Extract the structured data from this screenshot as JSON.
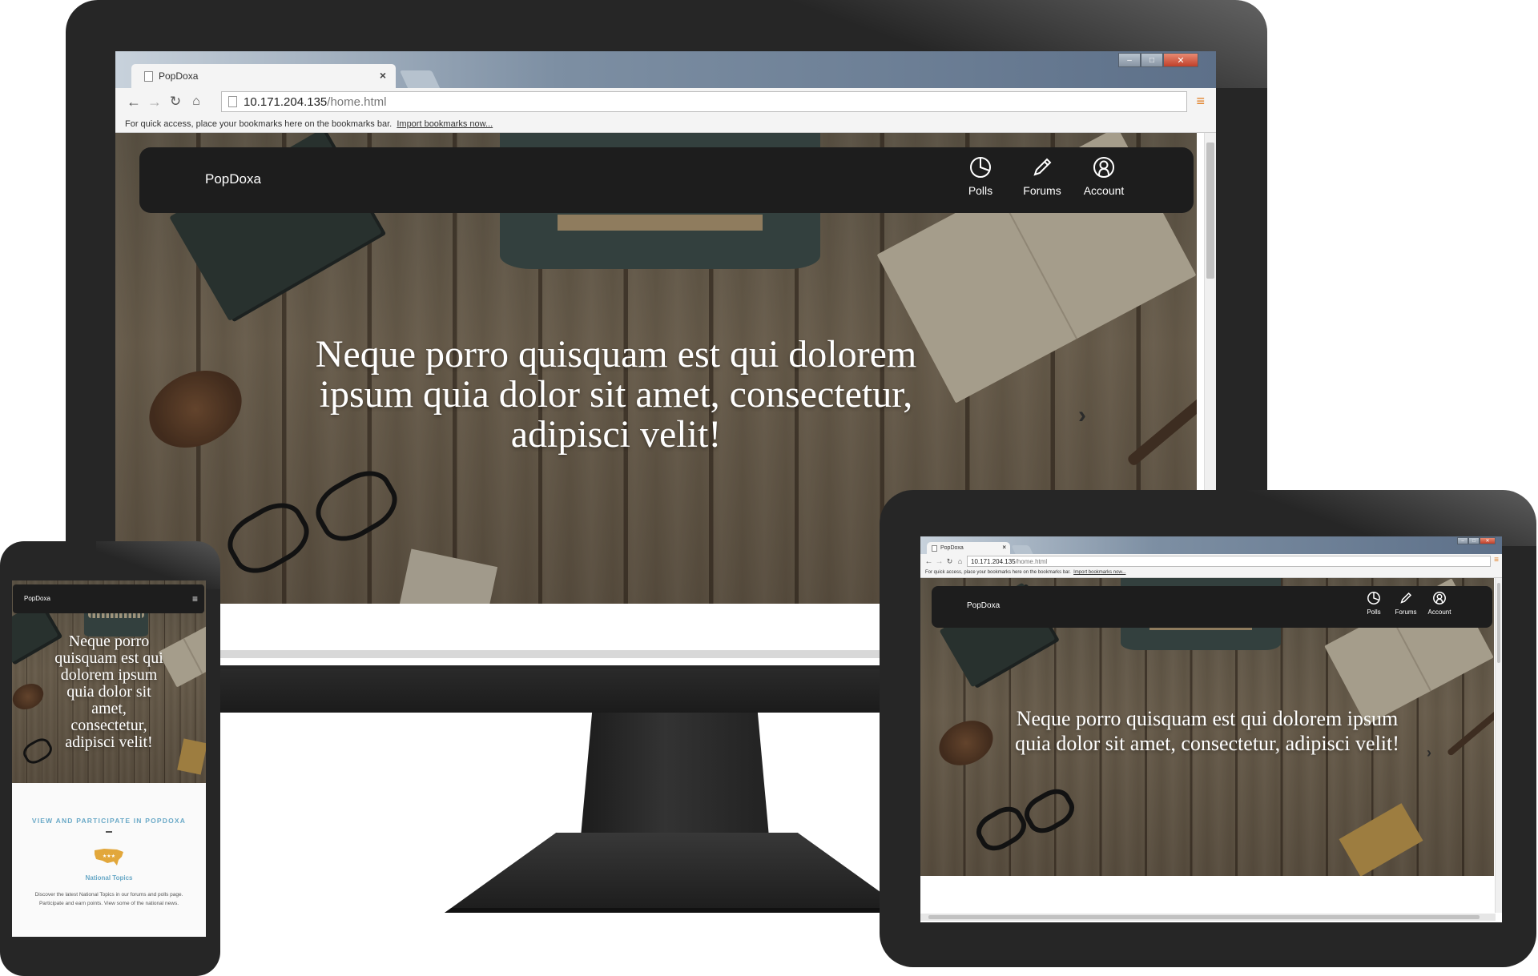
{
  "site": {
    "brand": "PopDoxa",
    "nav": [
      {
        "label": "Polls",
        "icon": "pie-chart-icon"
      },
      {
        "label": "Forums",
        "icon": "pencil-icon"
      },
      {
        "label": "Account",
        "icon": "user-icon"
      }
    ],
    "headline": "Neque porro quisquam est qui dolorem ipsum quia dolor sit amet, consectetur, adipisci velit!",
    "section_title": "VIEW AND PARTICIPATE IN POPDOXA",
    "topic_title": "National Topics",
    "topic_description": "Discover the latest National Topics in our forums and polls page. Participate and earn points. View some of the national news."
  },
  "browser": {
    "tab_title": "PopDoxa",
    "tab_close": "×",
    "url_host": "10.171.204.135",
    "url_path": "/home.html",
    "bookmarks_text": "For quick access, place your bookmarks here on the bookmarks bar.",
    "bookmarks_link": "Import bookmarks now...",
    "icons": {
      "back": "back-arrow-icon",
      "forward": "forward-arrow-icon",
      "reload": "reload-icon",
      "home": "home-icon",
      "page": "page-icon",
      "menu": "menu-icon",
      "minimize": "minimize-icon",
      "maximize": "maximize-icon",
      "close": "close-icon"
    }
  },
  "colors": {
    "navbar": "#1d1d1d",
    "accent_menu": "#e07a1c",
    "section_text": "#6aa9c7",
    "device": "#262626"
  }
}
